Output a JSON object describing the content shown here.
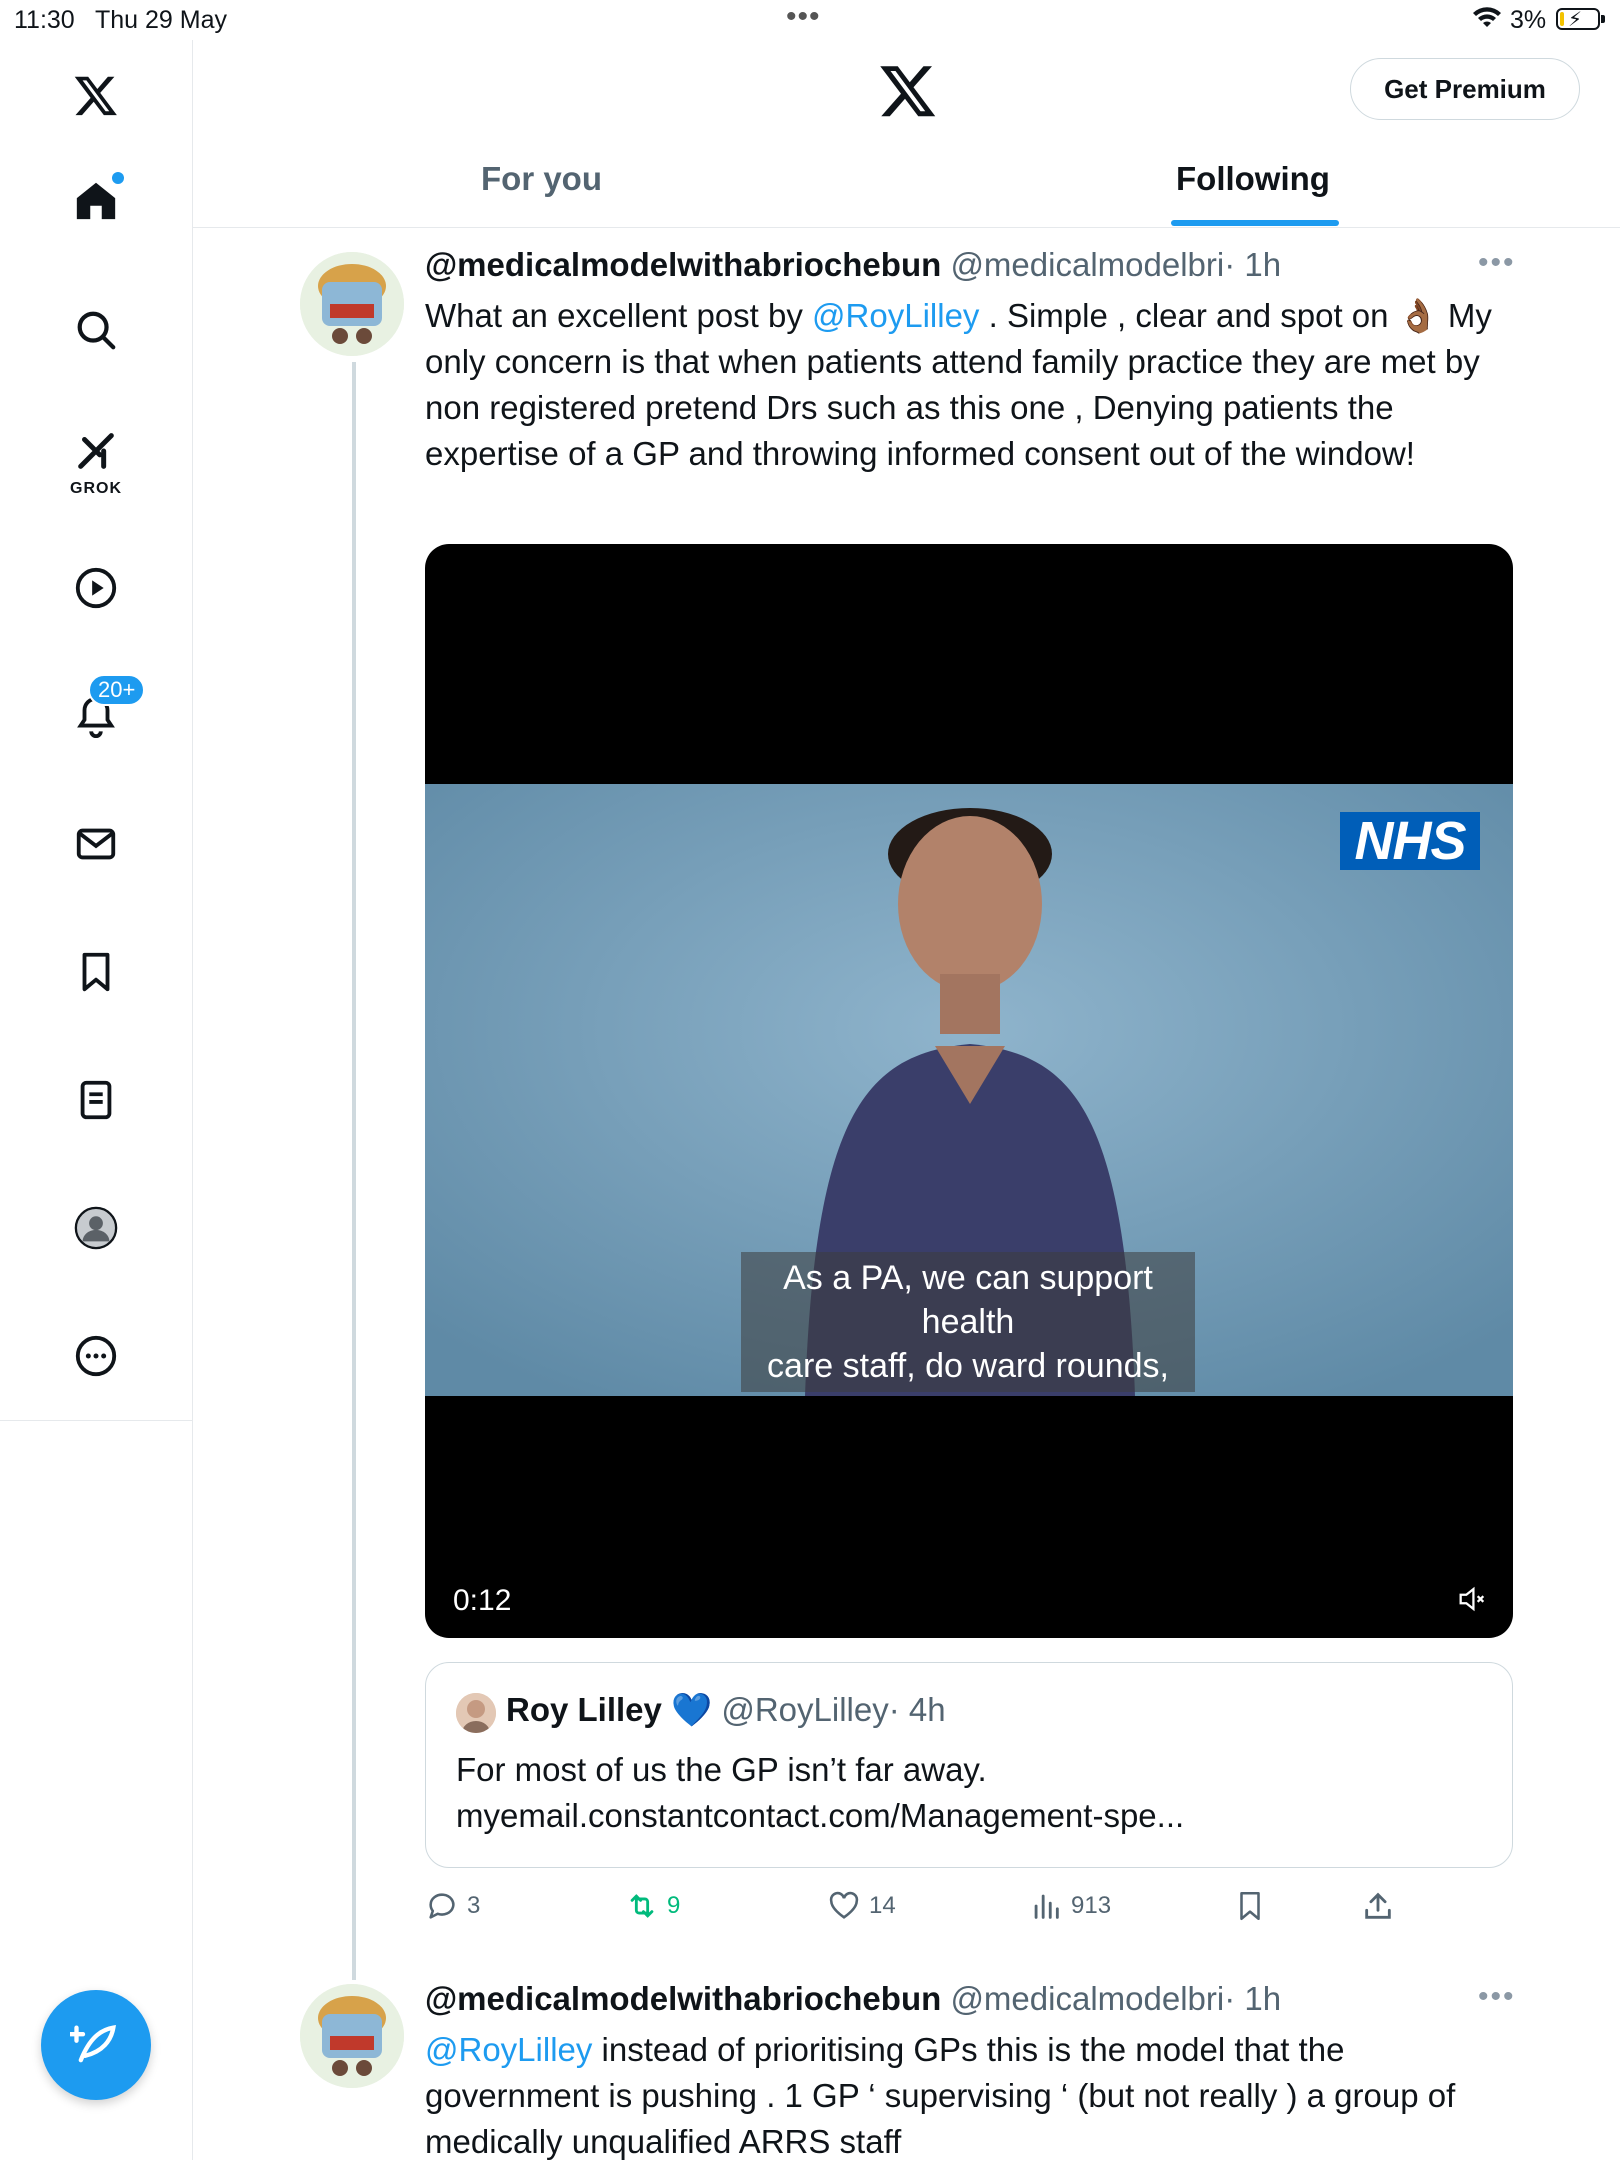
{
  "status_bar": {
    "time": "11:30",
    "date": "Thu 29 May",
    "battery": "3%"
  },
  "sidebar": {
    "items": [
      {
        "name": "home",
        "icon": "home-icon"
      },
      {
        "name": "search",
        "icon": "search-icon"
      },
      {
        "name": "grok",
        "icon": "grok-icon",
        "label": "GROK"
      },
      {
        "name": "video",
        "icon": "play-icon"
      },
      {
        "name": "notifications",
        "icon": "bell-icon",
        "badge": "20+"
      },
      {
        "name": "messages",
        "icon": "mail-icon"
      },
      {
        "name": "bookmarks",
        "icon": "bookmark-icon"
      },
      {
        "name": "lists",
        "icon": "list-icon"
      },
      {
        "name": "profile",
        "icon": "avatar-icon"
      },
      {
        "name": "more",
        "icon": "more-icon"
      }
    ],
    "compose_icon": "compose-icon"
  },
  "header": {
    "premium_label": "Get Premium",
    "tabs": [
      {
        "label": "For you"
      },
      {
        "label": "Following"
      }
    ]
  },
  "tweets": [
    {
      "name": "@medicalmodelwithabriochebun",
      "handle": "@medicalmodelbri",
      "time": "· 1h",
      "text_parts": {
        "p1": "What an excellent post by ",
        "mention": "@RoyLilley",
        "p2": " . Simple , clear and spot on 👌🏾 My only concern is that when patients attend family practice they are met by non registered pretend Drs such as this one , Denying patients the expertise of a GP and throwing informed consent out of the window!"
      },
      "video": {
        "logo": "NHS",
        "caption_line1": "As a PA, we can support health",
        "caption_line2": "care staff, do ward rounds,",
        "duration": "0:12"
      },
      "quote": {
        "name": "Roy Lilley",
        "verified": "💙",
        "handle": "@RoyLilley",
        "time": "· 4h",
        "text_line1": "For most of us the GP isn’t far away.",
        "text_line2": "myemail.constantcontact.com/Management-spe..."
      },
      "stats": {
        "replies": "3",
        "retweets": "9",
        "likes": "14",
        "views": "913"
      }
    },
    {
      "name": "@medicalmodelwithabriochebun",
      "handle": "@medicalmodelbri",
      "time": "· 1h",
      "text_parts": {
        "mention": "@RoyLilley",
        "p1": " instead of prioritising GPs this is the model that the government is pushing . 1 GP ‘ supervising ‘ (but not really ) a group of medically unqualified ARRS staff"
      }
    }
  ],
  "colors": {
    "accent": "#1d9bf0",
    "retweet": "#00ba7c",
    "muted_text": "#536471",
    "nhs_blue": "#005eb8"
  }
}
